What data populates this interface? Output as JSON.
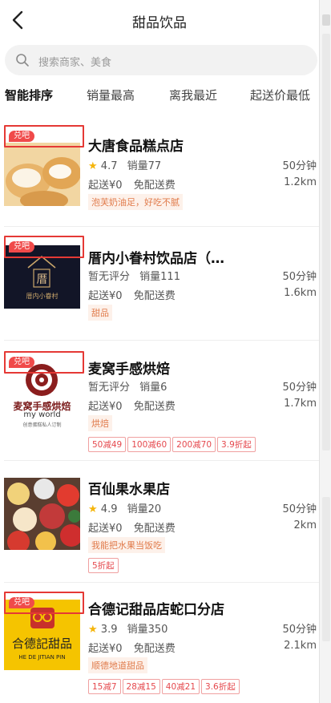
{
  "header": {
    "title": "甜品饮品",
    "back_icon": "chevron-left-icon"
  },
  "search": {
    "placeholder": "搜索商家、美食",
    "icon": "search-icon"
  },
  "sort_tabs": [
    "智能排序",
    "销量最高",
    "离我最近",
    "起送价最低"
  ],
  "active_tab": 0,
  "badge_text": "兑吧",
  "shops": [
    {
      "name": "大唐食品糕点店",
      "rating": "4.7",
      "sales": "销量77",
      "time": "50分钟",
      "min_order": "起送¥0",
      "delivery": "免配送费",
      "distance": "1.2km",
      "tag": "泡芙奶油足，好吃不腻",
      "promos": []
    },
    {
      "name": "厝内小眷村饮品店（…",
      "rating": "暂无评分",
      "sales": "销量111",
      "time": "50分钟",
      "min_order": "起送¥0",
      "delivery": "免配送费",
      "distance": "1.6km",
      "tag": "甜品",
      "promos": [],
      "logo": {
        "char": "厝",
        "text": "厝内小眷村"
      }
    },
    {
      "name": "麦窝手感烘焙",
      "rating": "暂无评分",
      "sales": "销量6",
      "time": "50分钟",
      "min_order": "起送¥0",
      "delivery": "免配送费",
      "distance": "1.7km",
      "tag": "烘焙",
      "promos": [
        "50减49",
        "100减60",
        "200减70",
        "3.9折起"
      ],
      "logo": {
        "text": "麦窝手感烘焙",
        "sub": "my world",
        "small": "创意蛋糕私人订制"
      }
    },
    {
      "name": "百仙果水果店",
      "rating": "4.9",
      "sales": "销量20",
      "time": "50分钟",
      "min_order": "起送¥0",
      "delivery": "免配送费",
      "distance": "2km",
      "tag": "我能把水果当饭吃",
      "promos": [
        "5折起"
      ]
    },
    {
      "name": "合德记甜品店蛇口分店",
      "rating": "3.9",
      "sales": "销量350",
      "time": "50分钟",
      "min_order": "起送¥0",
      "delivery": "免配送费",
      "distance": "2.1km",
      "tag": "顺德地道甜品",
      "promos": [
        "15减7",
        "28减15",
        "40减21",
        "3.6折起"
      ],
      "logo": {
        "text": "合德記甜品",
        "sub": "HE DE JITIAN PIN"
      }
    }
  ],
  "colors": {
    "accent": "#e53935",
    "star": "#f5b50a",
    "tag": "#e07a4a"
  }
}
